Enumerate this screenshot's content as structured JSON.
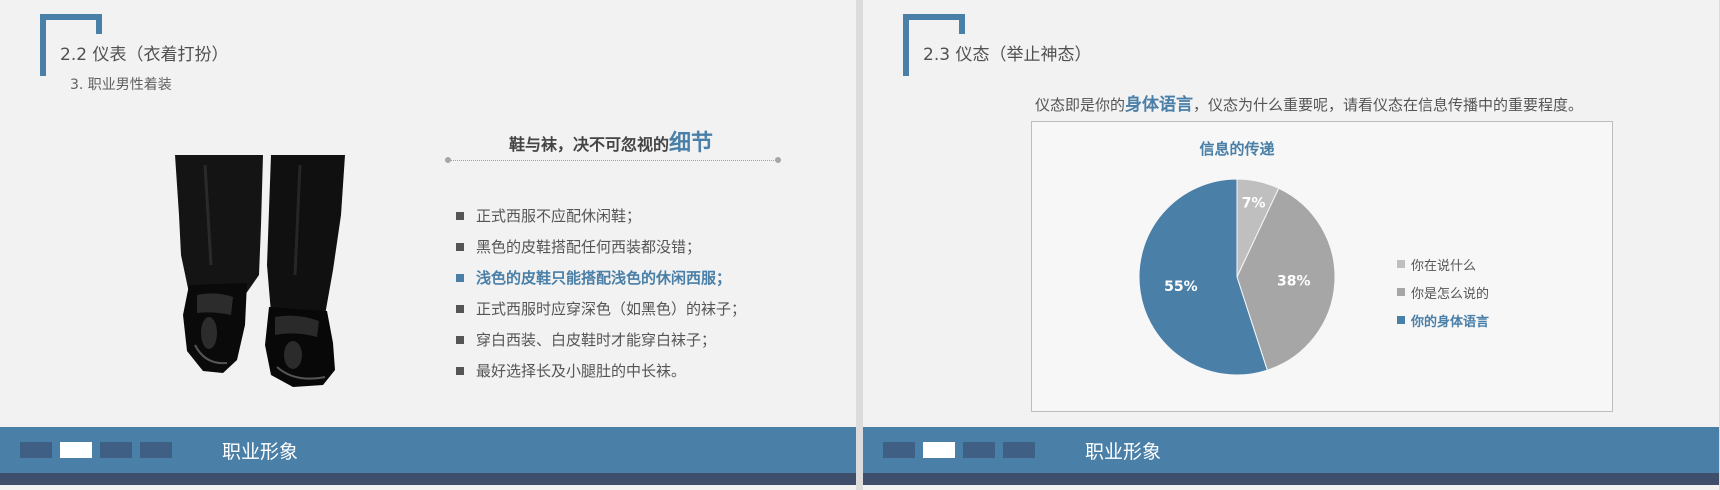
{
  "colors": {
    "accent": "#4a7fa8",
    "footer_dark": "#3f4e6b",
    "footer_square": "#3f5f84"
  },
  "left": {
    "section_title": "2.2  仪表（衣着打扮）",
    "subtitle": "3. 职业男性着装",
    "image": "dress-shoes-with-trousers",
    "headline_prefix": "鞋与袜，决不可忽视的",
    "headline_emphasis": "细节",
    "bullets": [
      {
        "text": "正式西服不应配休闲鞋；",
        "highlight": false
      },
      {
        "text": "黑色的皮鞋搭配任何西装都没错；",
        "highlight": false
      },
      {
        "text": "浅色的皮鞋只能搭配浅色的休闲西服；",
        "highlight": true
      },
      {
        "text": "正式西服时应穿深色（如黑色）的袜子；",
        "highlight": false
      },
      {
        "text": "穿白西装、白皮鞋时才能穿白袜子；",
        "highlight": false
      },
      {
        "text": "最好选择长及小腿肚的中长袜。",
        "highlight": false
      }
    ],
    "footer_label": "职业形象"
  },
  "right": {
    "section_title": "2.3  仪态（举止神态）",
    "intro_prefix": "仪态即是你的",
    "intro_emphasis": "身体语言",
    "intro_suffix": "，仪态为什么重要呢，请看仪态在信息传播中的重要程度。",
    "footer_label": "职业形象"
  },
  "chart_data": {
    "type": "pie",
    "title": "信息的传递",
    "categories": [
      "你在说什么",
      "你是怎么说的",
      "你的身体语言"
    ],
    "values": [
      7,
      38,
      55
    ],
    "labels": [
      "7%",
      "38%",
      "55%"
    ],
    "colors": [
      "#bfbfbf",
      "#a6a6a6",
      "#4a7fa8"
    ],
    "legend_position": "right"
  }
}
